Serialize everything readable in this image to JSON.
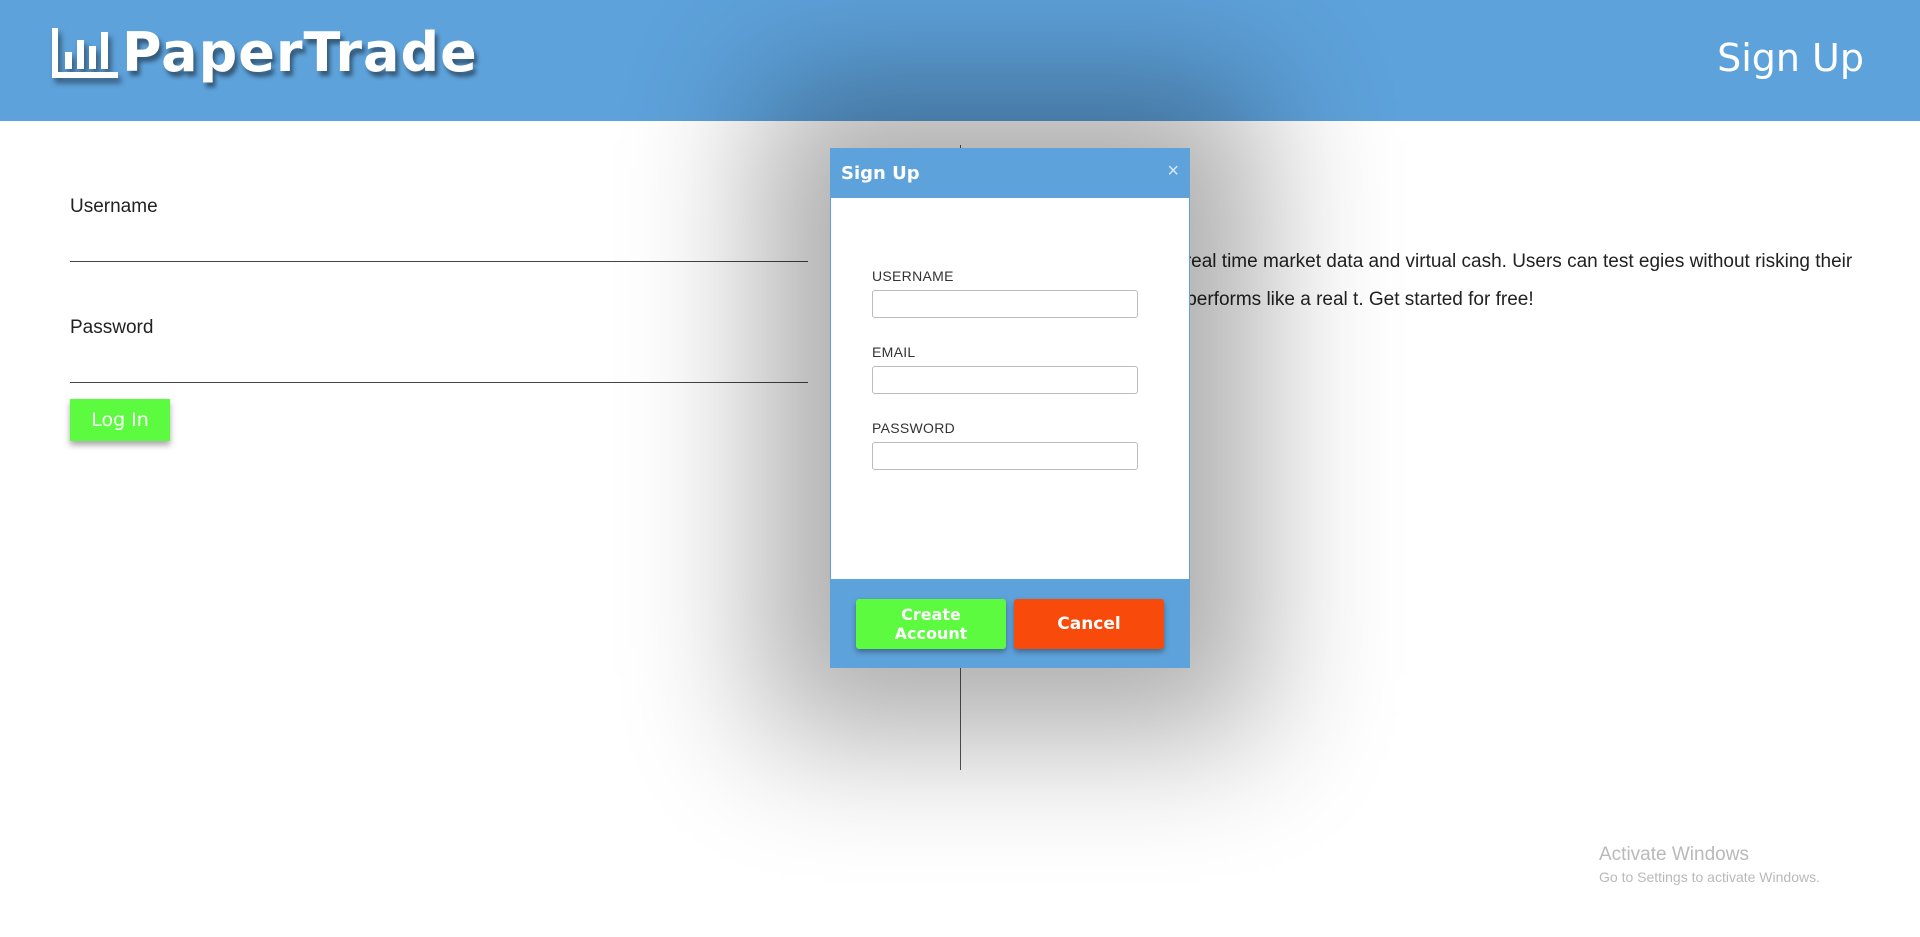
{
  "header": {
    "brand": "PaperTrade",
    "logo_icon": "bar-chart-icon",
    "signup_label": "Sign Up",
    "background_color": "#5ea2db"
  },
  "login": {
    "username_label": "Username",
    "username_value": "",
    "password_label": "Password",
    "password_value": "",
    "login_button_label": "Log In",
    "login_button_color": "#5dfb3f"
  },
  "about": {
    "visible_text": "ading simulator using real time market data and virtual cash. Users can test egies without risking their money. The simulator performs like a real t. Get started for free!"
  },
  "modal": {
    "title": "Sign Up",
    "close_icon": "close-icon",
    "close_glyph": "×",
    "fields": {
      "username_label": "USERNAME",
      "username_value": "",
      "email_label": "EMAIL",
      "email_value": "",
      "password_label": "PASSWORD",
      "password_value": ""
    },
    "create_button_label": "Create Account",
    "create_button_color": "#5dfb3f",
    "cancel_button_label": "Cancel",
    "cancel_button_color": "#f84a0a"
  },
  "watermark": {
    "title": "Activate Windows",
    "subtitle": "Go to Settings to activate Windows."
  }
}
